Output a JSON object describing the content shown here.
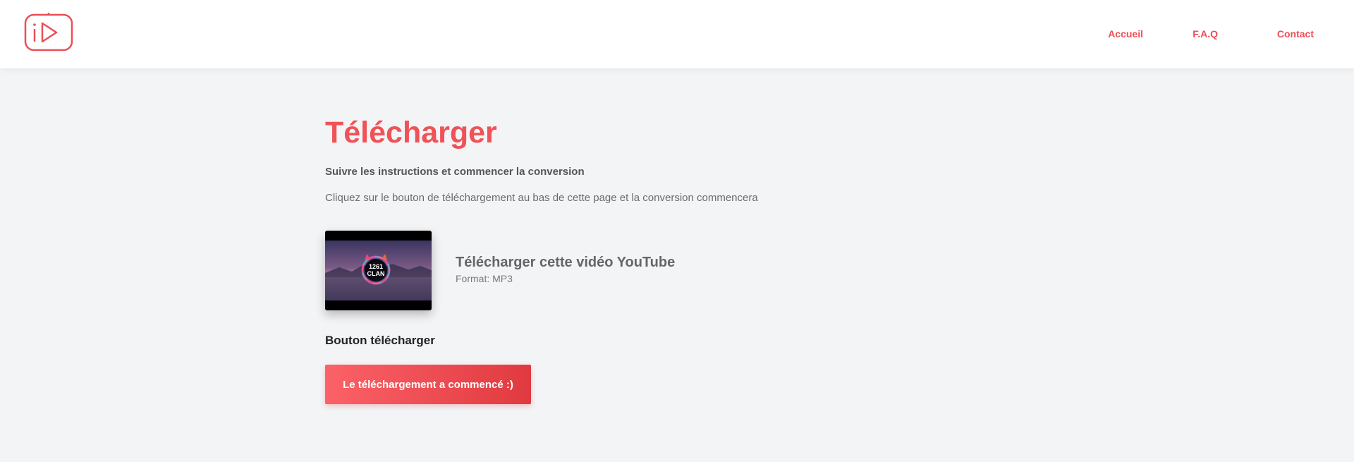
{
  "header": {
    "logo_icon": "youtube-play-icon",
    "nav": [
      {
        "label": "Accueil"
      },
      {
        "label": "F.A.Q"
      },
      {
        "label": "Contact"
      }
    ]
  },
  "main": {
    "title": "Télécharger",
    "subtitle": "Suivre les instructions et commencer la conversion",
    "description": "Cliquez sur le bouton de téléchargement au bas de cette page et la conversion commencera",
    "video": {
      "thumbnail_text": [
        "1261",
        "CLAN"
      ],
      "title": "Télécharger cette vidéo YouTube",
      "format": "Format: MP3"
    },
    "download_section_label": "Bouton télécharger",
    "download_button_label": "Le téléchargement a commencé :)"
  },
  "colors": {
    "accent": "#ef5257",
    "background": "#f3f4f6",
    "button_gradient_start": "#fb6267",
    "button_gradient_end": "#e03a40"
  }
}
